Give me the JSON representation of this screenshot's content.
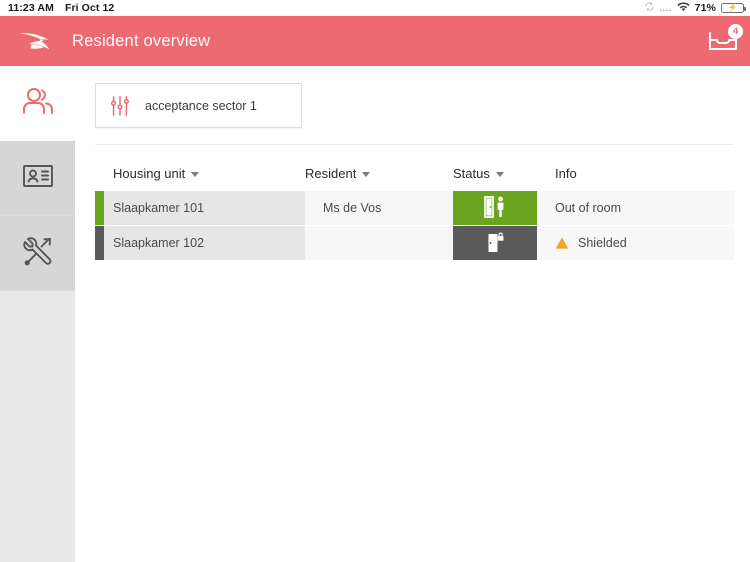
{
  "statusbar": {
    "time": "11:23 AM",
    "date": "Fri Oct 12",
    "dots": "....",
    "battery_percent": "71%",
    "rotation_icon": "rotation-lock-icon",
    "wifi_icon": "wifi-icon",
    "battery_icon": "battery-charging-icon"
  },
  "appbar": {
    "logo_icon": "swift-bird-logo",
    "title": "Resident overview",
    "inbox_icon": "inbox-tray-icon",
    "inbox_badge": "4",
    "background_color": "#ec6a70"
  },
  "sidebar": {
    "items": [
      {
        "name": "residents",
        "icon": "two-people-icon",
        "active": true
      },
      {
        "name": "id-card",
        "icon": "id-card-icon",
        "active": false
      },
      {
        "name": "tools",
        "icon": "tools-icon",
        "active": false
      }
    ]
  },
  "filter": {
    "icon": "sliders-filter-icon",
    "label": "acceptance sector 1"
  },
  "table": {
    "headers": [
      {
        "label": "Housing unit",
        "sortable": true
      },
      {
        "label": "Resident",
        "sortable": true
      },
      {
        "label": "Status",
        "sortable": true
      },
      {
        "label": "Info",
        "sortable": false
      }
    ],
    "rows": [
      {
        "accent_color": "#6aa520",
        "housing_unit": "Slaapkamer 101",
        "resident": "Ms de Vos",
        "status_icon": "door-open-person-icon",
        "status_color": "#6aa520",
        "info": "Out of room",
        "info_icon": null
      },
      {
        "accent_color": "#5a5a5a",
        "housing_unit": "Slaapkamer 102",
        "resident": "",
        "status_icon": "door-locked-icon",
        "status_color": "#5a5a5a",
        "info": "Shielded",
        "info_icon": "warning-triangle-icon"
      }
    ]
  }
}
